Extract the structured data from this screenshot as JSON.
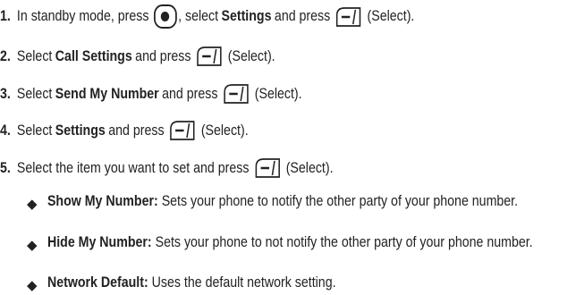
{
  "steps": [
    {
      "num": "1.",
      "a": "In standby mode, press",
      "b": ", select",
      "bold": "Settings",
      "c": "and press",
      "d": "(Select)."
    },
    {
      "num": "2.",
      "a": "Select",
      "bold": "Call Settings",
      "c": "and press",
      "d": "(Select)."
    },
    {
      "num": "3.",
      "a": "Select",
      "bold": "Send My Number",
      "c": "and press",
      "d": "(Select)."
    },
    {
      "num": "4.",
      "a": "Select",
      "bold": "Settings",
      "c": "and press",
      "d": "(Select)."
    },
    {
      "num": "5.",
      "a": "Select the item you want to set and press",
      "d": "(Select)."
    }
  ],
  "bullets": [
    {
      "term": "Show My Number:",
      "desc": "Sets your phone to notify the other party of your phone number."
    },
    {
      "term": "Hide My Number:",
      "desc": "Sets your phone to not notify the other party of your phone number."
    },
    {
      "term": "Network Default:",
      "desc": "Uses the default network setting."
    }
  ],
  "icons": {
    "nav_key": "center-navigation-key-icon",
    "soft_key": "left-softkey-select-icon",
    "bullet": "diamond-bullet-icon"
  }
}
